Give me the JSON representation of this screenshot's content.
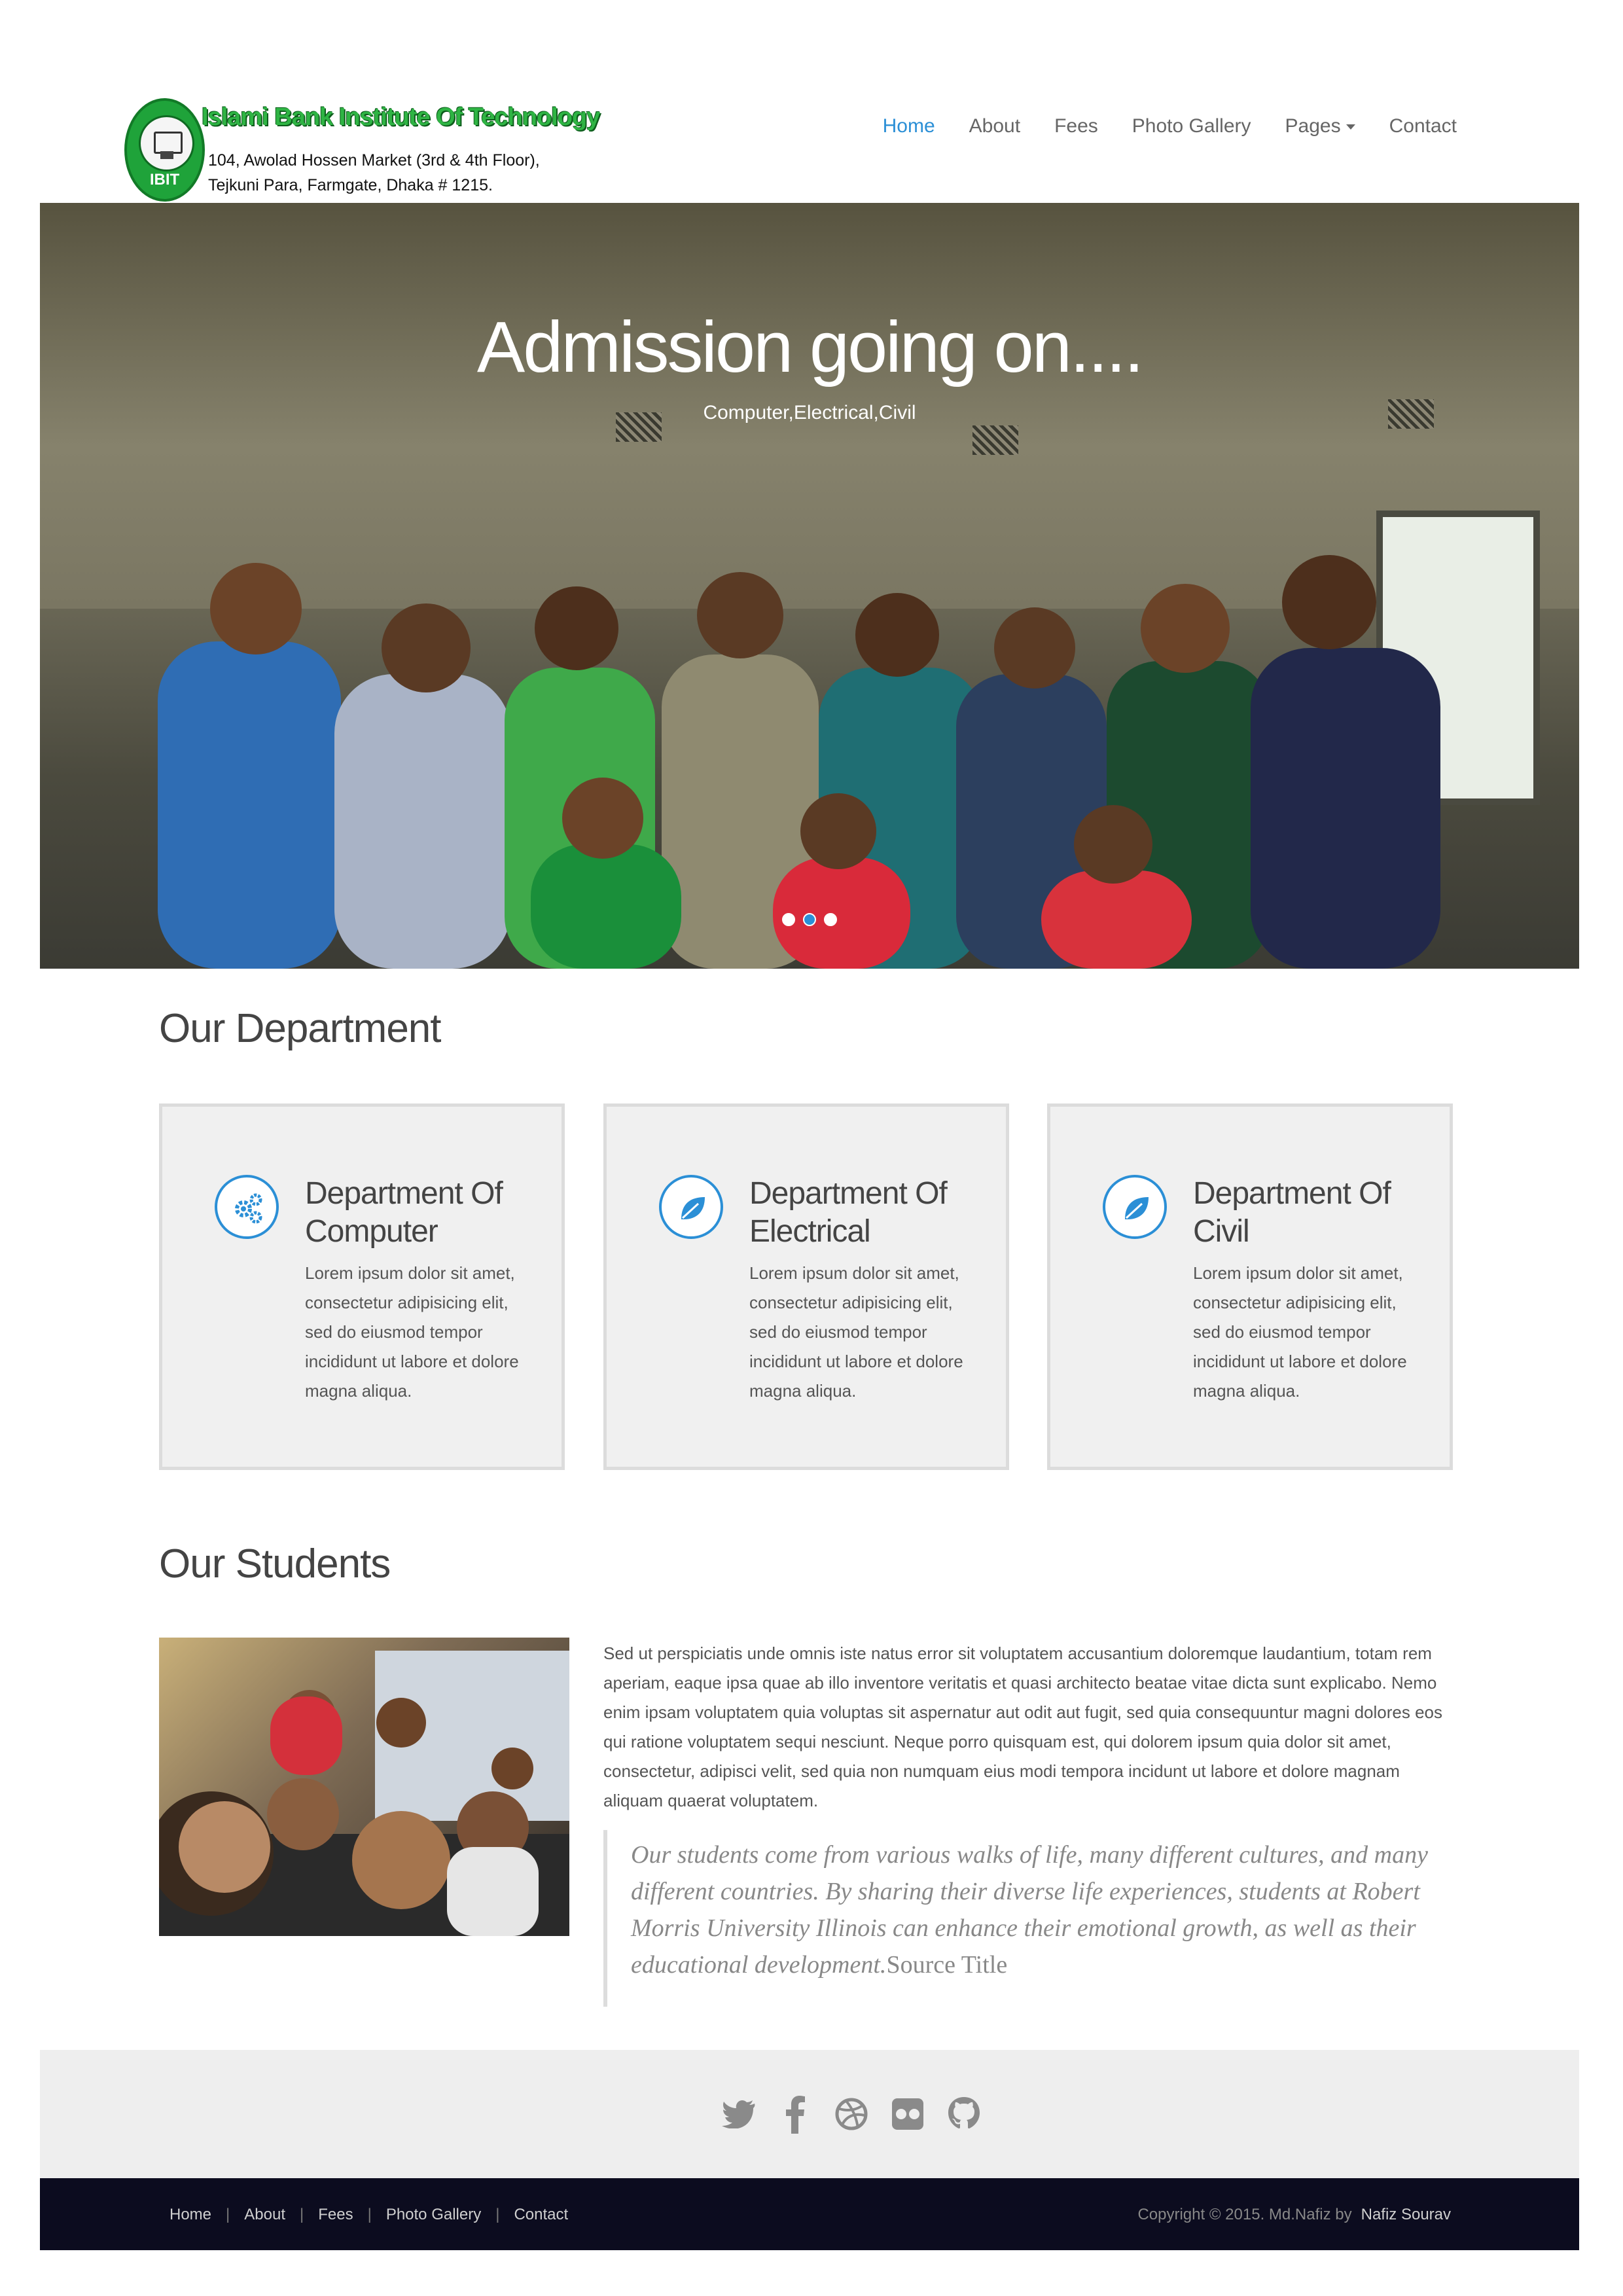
{
  "logo": {
    "name": "Islami Bank Institute Of Technology",
    "address_line1": "104, Awolad Hossen Market (3rd & 4th Floor),",
    "address_line2": "Tejkuni Para, Farmgate, Dhaka # 1215.",
    "seal_text": "IBIT"
  },
  "nav": {
    "items": [
      "Home",
      "About",
      "Fees",
      "Photo Gallery",
      "Pages",
      "Contact"
    ],
    "active": "Home"
  },
  "hero": {
    "title": "Admission going on....",
    "subtitle": "Computer,Electrical,Civil",
    "slides": 3,
    "active_slide": 2
  },
  "departments": {
    "heading": "Our Department",
    "cards": [
      {
        "title": "Department Of Computer",
        "icon": "gears-icon",
        "text": "Lorem ipsum dolor sit amet, consectetur adipisicing elit, sed do eiusmod tempor incididunt ut labore et dolore magna aliqua."
      },
      {
        "title": "Department Of Electrical",
        "icon": "leaf-icon",
        "text": "Lorem ipsum dolor sit amet, consectetur adipisicing elit, sed do eiusmod tempor incididunt ut labore et dolore magna aliqua."
      },
      {
        "title": "Department Of Civil",
        "icon": "leaf-icon",
        "text": "Lorem ipsum dolor sit amet, consectetur adipisicing elit, sed do eiusmod tempor incididunt ut labore et dolore magna aliqua."
      }
    ]
  },
  "students": {
    "heading": "Our Students",
    "paragraph": "Sed ut perspiciatis unde omnis iste natus error sit voluptatem accusantium doloremque laudantium, totam rem aperiam, eaque ipsa quae ab illo inventore veritatis et quasi architecto beatae vitae dicta sunt explicabo. Nemo enim ipsam voluptatem quia voluptas sit aspernatur aut odit aut fugit, sed quia consequuntur magni dolores eos qui ratione voluptatem sequi nesciunt. Neque porro quisquam est, qui dolorem ipsum quia dolor sit amet, consectetur, adipisci velit, sed quia non numquam eius modi tempora incidunt ut labore et dolore magnam aliquam quaerat voluptatem.",
    "quote": "Our students come from various walks of life, many different cultures, and many different countries. By sharing their diverse life experiences, students at Robert Morris University Illinois can enhance their emotional growth, as well as their educational development.",
    "quote_source": "Source Title"
  },
  "footer": {
    "social": [
      "twitter-icon",
      "facebook-icon",
      "dribbble-icon",
      "flickr-icon",
      "github-icon"
    ],
    "links": [
      "Home",
      "About",
      "Fees",
      "Photo Gallery",
      "Contact"
    ],
    "copyright": "Copyright © 2015. Md.Nafiz by",
    "author": "Nafiz Sourav"
  },
  "colors": {
    "accent": "#2b8fd6",
    "footer_dark": "#0c0c1f",
    "logo_green": "#2fb444"
  }
}
